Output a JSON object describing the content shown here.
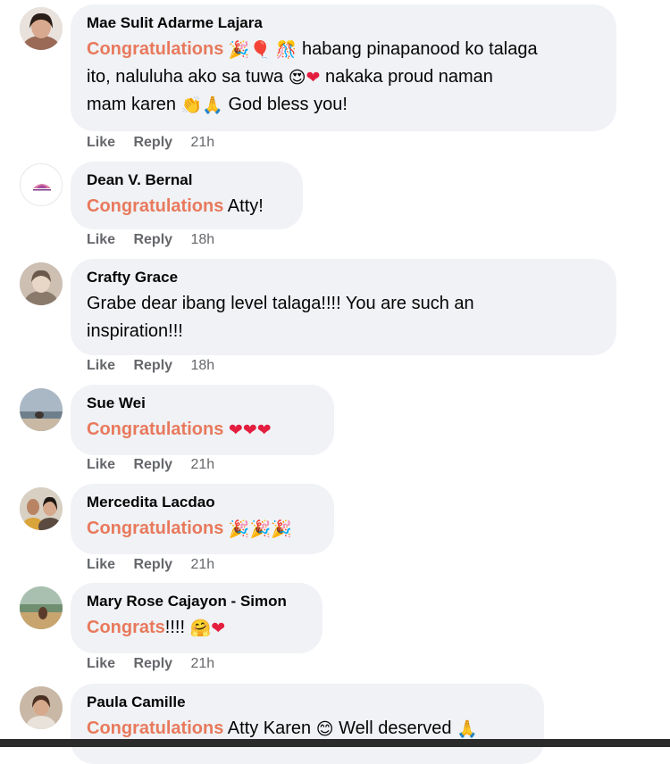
{
  "comments": [
    {
      "author": "Mae Sulit Adarme Lajara",
      "highlight": "Congratulations",
      "emoji_a": "🎉🎈",
      "emoji_b": "🎊",
      "line1_rest": "habang pinapanood ko talaga",
      "line2": "ito, naluluha ako sa tuwa",
      "emoji_c": "😍",
      "heart": "❤",
      "line2_rest": "nakaka proud naman",
      "line3": "mam karen",
      "emoji_d": "👏🙏",
      "line3_rest": "God bless you!",
      "like": "Like",
      "reply": "Reply",
      "time": "21h"
    },
    {
      "author": "Dean V. Bernal",
      "highlight": "Congratulations",
      "rest": "Atty!",
      "like": "Like",
      "reply": "Reply",
      "time": "18h"
    },
    {
      "author": "Crafty Grace",
      "line1": "Grabe dear ibang level talaga!!!! You are such an",
      "line2": "inspiration!!!",
      "like": "Like",
      "reply": "Reply",
      "time": "18h"
    },
    {
      "author": "Sue Wei",
      "highlight": "Congratulations",
      "hearts": "❤❤❤",
      "like": "Like",
      "reply": "Reply",
      "time": "21h"
    },
    {
      "author": "Mercedita Lacdao",
      "highlight": "Congratulations",
      "emojis": "🎉🎉🎉",
      "like": "Like",
      "reply": "Reply",
      "time": "21h"
    },
    {
      "author": "Mary Rose Cajayon - Simon",
      "highlight": "Congrats",
      "exclaim": "!!!!",
      "emoji": "🤗",
      "heart": "❤",
      "like": "Like",
      "reply": "Reply",
      "time": "21h"
    },
    {
      "author": "Paula Camille",
      "highlight": "Congratulations",
      "rest1": "Atty Karen",
      "emoji": "😊",
      "rest2": "Well deserved",
      "emoji2": "🙏"
    }
  ],
  "colors": {
    "bubble": "#f0f2f5",
    "highlight": "#e8795c",
    "meta": "#65676b",
    "heart": "#e41e3f"
  },
  "icons": {
    "avatar": "profile-photo"
  }
}
